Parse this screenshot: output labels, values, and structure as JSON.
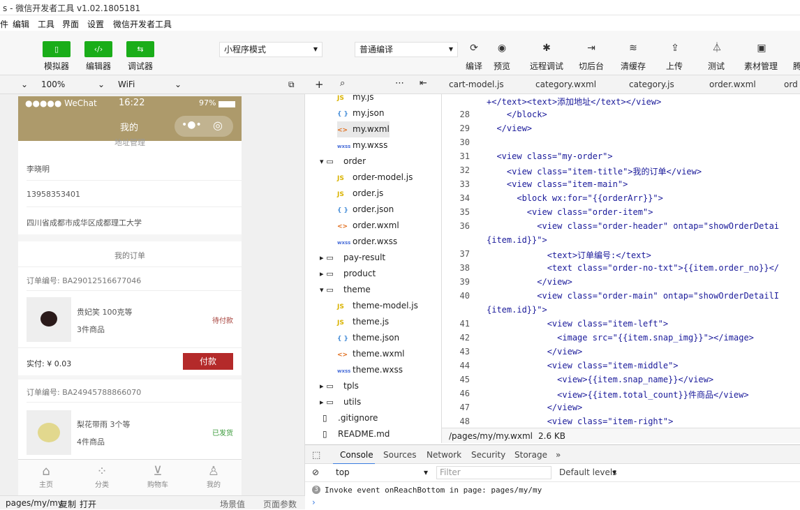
{
  "window": {
    "title": "s - 微信开发者工具 v1.02.1805181"
  },
  "menu": [
    "件",
    "编辑",
    "工具",
    "界面",
    "设置",
    "微信开发者工具"
  ],
  "toolbar": {
    "simulator": "模拟器",
    "editor": "编辑器",
    "debugger": "调试器",
    "mode": "小程序模式",
    "compile": "普通编译",
    "actions": [
      "编译",
      "预览",
      "远程调试",
      "切后台",
      "清缓存",
      "上传",
      "测试",
      "素材管理",
      "腾"
    ]
  },
  "simbar": {
    "zoom": "100%",
    "network": "WiFi"
  },
  "phone": {
    "status": {
      "carrier": "●●●●● WeChat",
      "time": "16:22",
      "battery": "97%"
    },
    "title": "我的",
    "address_header": "地址管理",
    "name": "李晓明",
    "phone": "13958353401",
    "address": "四川省成都市成华区成都理工大学",
    "orders_title": "我的订单",
    "orders": [
      {
        "no": "订单编号: BA29012516677046",
        "name": "贵妃笑 100克等",
        "count": "3件商品",
        "status": "待付款",
        "paid": "实付: ¥ 0.03",
        "button": "付款"
      },
      {
        "no": "订单编号: BA24945788866070",
        "name": "梨花带雨 3个等",
        "count": "4件商品",
        "status": "已发货"
      }
    ],
    "tabs": [
      "主页",
      "分类",
      "购物车",
      "我的"
    ]
  },
  "leftfoot": {
    "path": "pages/my/my",
    "copy": "复制",
    "open": "打开",
    "scene": "场景值",
    "params": "页面参数"
  },
  "tree": [
    {
      "name": "my.js",
      "type": "js",
      "indent": 2
    },
    {
      "name": "my.json",
      "type": "json",
      "indent": 2
    },
    {
      "name": "my.wxml",
      "type": "wxml",
      "indent": 2
    },
    {
      "name": "my.wxss",
      "type": "wxss",
      "indent": 2
    },
    {
      "name": "order",
      "type": "folder-open",
      "indent": 1
    },
    {
      "name": "order-model.js",
      "type": "js",
      "indent": 2
    },
    {
      "name": "order.js",
      "type": "js",
      "indent": 2
    },
    {
      "name": "order.json",
      "type": "json",
      "indent": 2
    },
    {
      "name": "order.wxml",
      "type": "wxml",
      "indent": 2
    },
    {
      "name": "order.wxss",
      "type": "wxss",
      "indent": 2
    },
    {
      "name": "pay-result",
      "type": "folder",
      "indent": 1
    },
    {
      "name": "product",
      "type": "folder",
      "indent": 1
    },
    {
      "name": "theme",
      "type": "folder-open",
      "indent": 1
    },
    {
      "name": "theme-model.js",
      "type": "js",
      "indent": 2
    },
    {
      "name": "theme.js",
      "type": "js",
      "indent": 2
    },
    {
      "name": "theme.json",
      "type": "json",
      "indent": 2
    },
    {
      "name": "theme.wxml",
      "type": "wxml",
      "indent": 2
    },
    {
      "name": "theme.wxss",
      "type": "wxss",
      "indent": 2
    },
    {
      "name": "tpls",
      "type": "folder",
      "indent": 1
    },
    {
      "name": "utils",
      "type": "folder",
      "indent": 0
    },
    {
      "name": ".gitignore",
      "type": "file",
      "indent": 0
    },
    {
      "name": "README.md",
      "type": "file",
      "indent": 0
    }
  ],
  "editor_tabs": [
    "cart-model.js",
    "category.wxml",
    "category.js",
    "order.wxml",
    "ord"
  ],
  "code": [
    {
      "n": "",
      "t": "+</text><text>添加地址</text></view>"
    },
    {
      "n": "28",
      "t": "    </block>"
    },
    {
      "n": "29",
      "t": "  </view>"
    },
    {
      "n": "30",
      "t": ""
    },
    {
      "n": "31",
      "t": "  <view class=\"my-order\">"
    },
    {
      "n": "32",
      "t": "    <view class=\"item-title\">我的订单</view>"
    },
    {
      "n": "33",
      "t": "    <view class=\"item-main\">"
    },
    {
      "n": "34",
      "t": "      <block wx:for=\"{{orderArr}}\">"
    },
    {
      "n": "35",
      "t": "        <view class=\"order-item\">"
    },
    {
      "n": "36",
      "t": "          <view class=\"order-header\" ontap=\"showOrderDetai"
    },
    {
      "n": "",
      "t": "{item.id}}\">"
    },
    {
      "n": "37",
      "t": "            <text>订单编号:</text>"
    },
    {
      "n": "38",
      "t": "            <text class=\"order-no-txt\">{{item.order_no}}</"
    },
    {
      "n": "39",
      "t": "          </view>"
    },
    {
      "n": "40",
      "t": "          <view class=\"order-main\" ontap=\"showOrderDetailI"
    },
    {
      "n": "",
      "t": "{item.id}}\">"
    },
    {
      "n": "41",
      "t": "            <view class=\"item-left\">"
    },
    {
      "n": "42",
      "t": "              <image src=\"{{item.snap_img}}\"></image>"
    },
    {
      "n": "43",
      "t": "            </view>"
    },
    {
      "n": "44",
      "t": "            <view class=\"item-middle\">"
    },
    {
      "n": "45",
      "t": "              <view>{{item.snap_name}}</view>"
    },
    {
      "n": "46",
      "t": "              <view>{{item.total_count}}件商品</view>"
    },
    {
      "n": "47",
      "t": "            </view>"
    },
    {
      "n": "48",
      "t": "            <view class=\"item-right\">"
    }
  ],
  "editor_status": {
    "path": "/pages/my/my.wxml",
    "size": "2.6 KB"
  },
  "devtools": {
    "tabs": [
      "Console",
      "Sources",
      "Network",
      "Security",
      "Storage"
    ],
    "context": "top",
    "filter": "Filter",
    "levels": "Default levels",
    "log": "Invoke event onReachBottom in page: pages/my/my"
  }
}
